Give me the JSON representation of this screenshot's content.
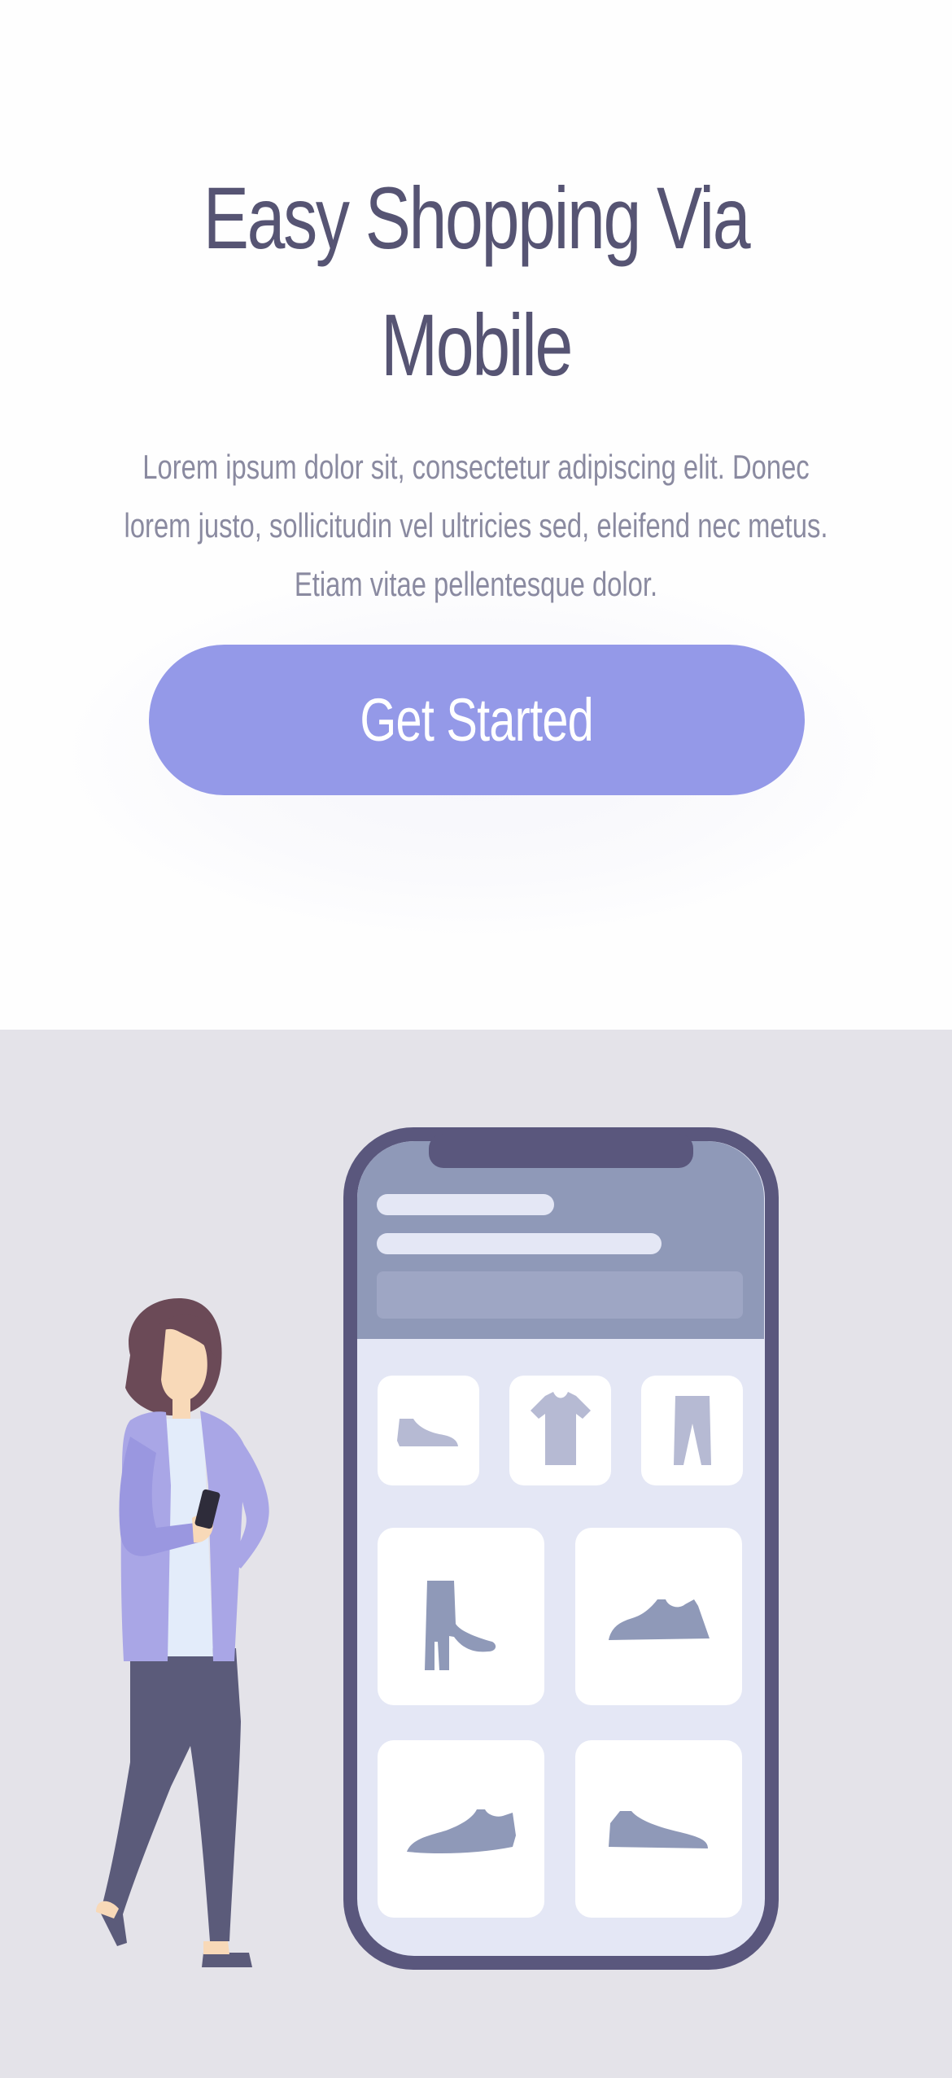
{
  "hero": {
    "title_line1": "Easy Shopping Via",
    "title_line2": "Mobile",
    "description": "Lorem ipsum dolor sit, consectetur adipiscing elit. Donec\nlorem justo, sollicitudin vel ultricies sed, eleifend nec metus.\nEtiam vitae pellentesque dolor.",
    "cta_label": "Get Started"
  },
  "colors": {
    "heading": "#565473",
    "body_text": "#8a8aa0",
    "accent": "#9499e8",
    "illustration_background": "#e4e3e9",
    "phone_frame": "#5a577d",
    "phone_header": "#8f99b8",
    "phone_screen": "#e4e7f5"
  },
  "illustration": {
    "phone_categories": [
      "shoe-icon",
      "tshirt-icon",
      "pants-icon"
    ],
    "phone_products": [
      "boot-icon",
      "sneaker-icon",
      "flat-shoe-icon",
      "sneaker-icon"
    ]
  }
}
